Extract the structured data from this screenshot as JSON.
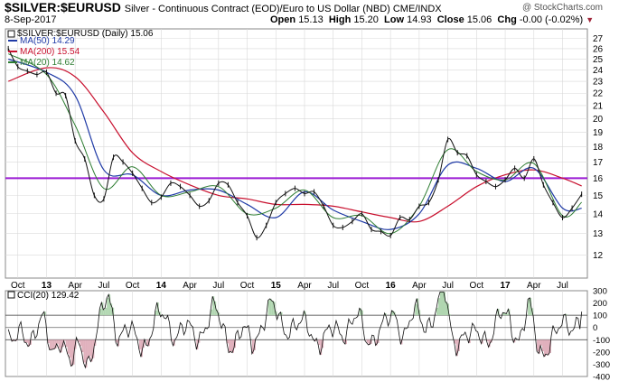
{
  "header": {
    "symbol": "$SILVER:$EURUSD",
    "description": "Silver - Continuous Contract (EOD)/Euro to US Dollar (NBD)  CME/INDX",
    "date": "8-Sep-2017",
    "open_label": "Open",
    "open": "15.13",
    "high_label": "High",
    "high": "15.20",
    "low_label": "Low",
    "low": "14.93",
    "close_label": "Close",
    "close": "15.06",
    "chg_label": "Chg",
    "chg": "-0.00 (-0.02%)",
    "brand": "@ StockCharts.com"
  },
  "legend": {
    "price": "$SILVER:$EURUSD (Daily) 15.06",
    "ma50": "MA(50) 14.29",
    "ma200": "MA(200) 15.54",
    "ma20": "MA(20) 14.62",
    "cci": "CCI(20) 129.42"
  },
  "colors": {
    "price": "#111111",
    "ma50": "#1f3aa6",
    "ma200": "#c8102e",
    "ma20": "#2e7d32",
    "hline": "#9b1bd4",
    "grid": "#d9d9d9",
    "cci_up": "#b0d6b0",
    "cci_down": "#e0b0bc"
  },
  "chart_data": {
    "type": "line",
    "title": "$SILVER:$EURUSD",
    "y_scale": "log",
    "ylim": [
      11,
      28
    ],
    "y_ticks": [
      "27",
      "26",
      "25",
      "24",
      "23",
      "22",
      "21",
      "20",
      "19",
      "18",
      "17",
      "16",
      "15",
      "14",
      "13",
      "12"
    ],
    "x_tick_labels": [
      "Oct",
      "13",
      "Apr",
      "Jul",
      "Oct",
      "14",
      "Apr",
      "Jul",
      "Oct",
      "15",
      "Apr",
      "Jul",
      "Oct",
      "16",
      "Apr",
      "Jul",
      "Oct",
      "17",
      "Apr",
      "Jul"
    ],
    "horizontal_line": 16,
    "series": [
      {
        "name": "$SILVER:$EURUSD (Daily)",
        "x": [
          "2012-09",
          "2012-10",
          "2012-11",
          "2012-12",
          "2013-01",
          "2013-02",
          "2013-03",
          "2013-04",
          "2013-05",
          "2013-06",
          "2013-07",
          "2013-08",
          "2013-09",
          "2013-10",
          "2013-11",
          "2013-12",
          "2014-01",
          "2014-02",
          "2014-03",
          "2014-04",
          "2014-05",
          "2014-06",
          "2014-07",
          "2014-08",
          "2014-09",
          "2014-10",
          "2014-11",
          "2014-12",
          "2015-01",
          "2015-02",
          "2015-03",
          "2015-04",
          "2015-05",
          "2015-06",
          "2015-07",
          "2015-08",
          "2015-09",
          "2015-10",
          "2015-11",
          "2015-12",
          "2016-01",
          "2016-02",
          "2016-03",
          "2016-04",
          "2016-05",
          "2016-06",
          "2016-07",
          "2016-08",
          "2016-09",
          "2016-10",
          "2016-11",
          "2016-12",
          "2017-01",
          "2017-02",
          "2017-03",
          "2017-04",
          "2017-05",
          "2017-06",
          "2017-07",
          "2017-08",
          "2017-09"
        ],
        "values": [
          26.0,
          24.3,
          23.9,
          23.6,
          23.8,
          22.0,
          21.8,
          18.4,
          17.2,
          15.0,
          14.8,
          17.3,
          17.0,
          16.3,
          15.4,
          14.6,
          14.9,
          15.7,
          15.5,
          15.0,
          14.4,
          14.7,
          15.7,
          15.6,
          14.6,
          13.9,
          12.8,
          13.4,
          14.6,
          15.1,
          15.4,
          15.1,
          15.2,
          14.4,
          13.4,
          13.3,
          13.6,
          14.0,
          13.2,
          13.1,
          12.9,
          13.8,
          13.7,
          14.4,
          14.6,
          15.9,
          18.5,
          17.6,
          17.4,
          16.2,
          15.8,
          15.5,
          15.9,
          16.6,
          16.0,
          17.2,
          15.6,
          14.6,
          13.8,
          14.3,
          15.06
        ]
      },
      {
        "name": "MA(50)",
        "x": [
          "2012-09",
          "2013-01",
          "2013-04",
          "2013-07",
          "2013-10",
          "2014-01",
          "2014-04",
          "2014-07",
          "2014-10",
          "2015-01",
          "2015-04",
          "2015-07",
          "2015-10",
          "2016-01",
          "2016-04",
          "2016-07",
          "2016-10",
          "2017-01",
          "2017-04",
          "2017-07",
          "2017-09"
        ],
        "values": [
          25.0,
          23.8,
          21.8,
          16.5,
          16.2,
          15.0,
          15.3,
          15.3,
          14.5,
          13.8,
          15.2,
          14.2,
          13.6,
          13.2,
          14.0,
          16.8,
          16.6,
          15.8,
          16.6,
          14.3,
          14.29
        ]
      },
      {
        "name": "MA(200)",
        "x": [
          "2012-09",
          "2013-01",
          "2013-04",
          "2013-07",
          "2013-10",
          "2014-01",
          "2014-04",
          "2014-07",
          "2014-10",
          "2015-01",
          "2015-04",
          "2015-07",
          "2015-10",
          "2016-01",
          "2016-04",
          "2016-07",
          "2016-10",
          "2017-01",
          "2017-04",
          "2017-07",
          "2017-09"
        ],
        "values": [
          23.0,
          24.2,
          23.4,
          20.5,
          17.6,
          16.4,
          15.6,
          15.0,
          14.8,
          14.5,
          14.5,
          14.4,
          14.1,
          13.8,
          13.6,
          14.4,
          15.5,
          16.2,
          16.5,
          16.0,
          15.54
        ]
      },
      {
        "name": "MA(20)",
        "x": [
          "2012-09",
          "2013-01",
          "2013-04",
          "2013-07",
          "2013-10",
          "2014-01",
          "2014-04",
          "2014-07",
          "2014-10",
          "2015-01",
          "2015-04",
          "2015-07",
          "2015-10",
          "2016-01",
          "2016-04",
          "2016-07",
          "2016-10",
          "2017-01",
          "2017-04",
          "2017-07",
          "2017-09"
        ],
        "values": [
          25.5,
          23.6,
          19.5,
          15.4,
          16.7,
          15.0,
          15.2,
          15.5,
          14.0,
          14.3,
          15.3,
          13.8,
          13.9,
          13.0,
          14.4,
          17.8,
          16.4,
          15.9,
          16.9,
          13.9,
          14.62
        ]
      }
    ],
    "cci": {
      "name": "CCI(20)",
      "last": 129.42,
      "ylim": [
        -400,
        300
      ],
      "y_ticks": [
        "300",
        "200",
        "100",
        "0",
        "-100",
        "-200",
        "-300",
        "-400"
      ],
      "reference_lines": [
        100,
        0,
        -100
      ]
    }
  }
}
